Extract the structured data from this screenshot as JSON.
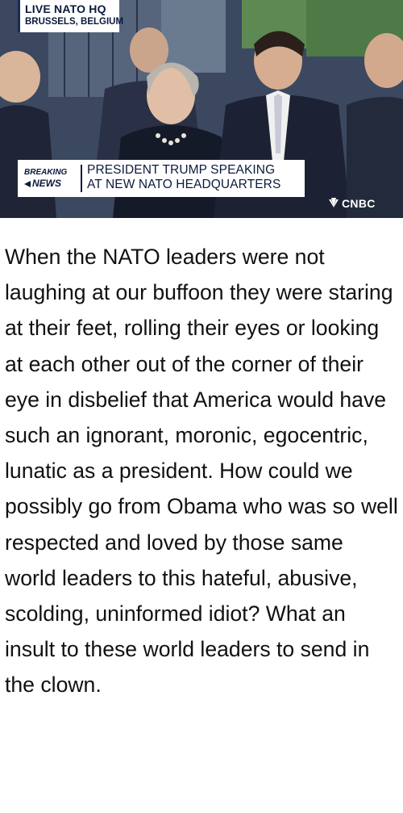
{
  "broadcast": {
    "location_line1": "LIVE NATO HQ",
    "location_line2": "BRUSSELS, BELGIUM",
    "breaking_label": "BREAKING",
    "news_label": "NEWS",
    "headline_line1": "PRESIDENT TRUMP SPEAKING",
    "headline_line2": "AT NEW NATO HEADQUARTERS",
    "network_name": "CNBC",
    "network_icon": "peacock-icon"
  },
  "caption": {
    "text": "When the NATO leaders were not laughing at our buffoon they were staring at their feet, rolling their eyes or looking at each other out of the corner of their eye in disbelief that America would have such an ignorant, moronic, egocentric, lunatic as a president. How could we possibly go from Obama who was so well respected and loved by those same world leaders to this hateful, abusive, scolding, uninformed idiot? What an insult to these world leaders to send in the clown."
  },
  "colors": {
    "navy": "#0b1a3c",
    "caption_text": "#111111",
    "background": "#ffffff"
  }
}
